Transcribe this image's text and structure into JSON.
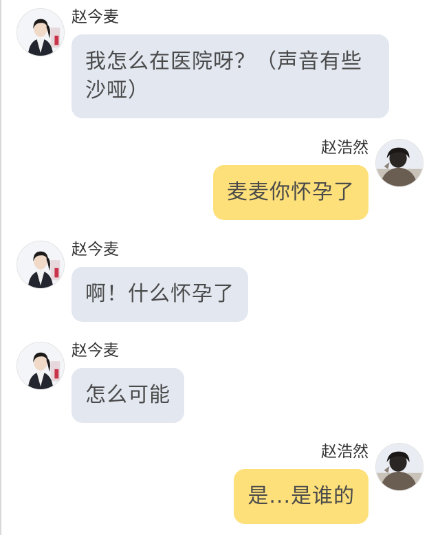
{
  "chat": {
    "messages": [
      {
        "side": "left",
        "sender": "赵今麦",
        "text": "我怎么在医院呀？（声音有些沙哑）",
        "avatar_icon": "girl-avatar-icon"
      },
      {
        "side": "right",
        "sender": "赵浩然",
        "text": "麦麦你怀孕了",
        "avatar_icon": "boy-avatar-icon"
      },
      {
        "side": "left",
        "sender": "赵今麦",
        "text": "啊！什么怀孕了",
        "avatar_icon": "girl-avatar-icon"
      },
      {
        "side": "left",
        "sender": "赵今麦",
        "text": "怎么可能",
        "avatar_icon": "girl-avatar-icon"
      },
      {
        "side": "right",
        "sender": "赵浩然",
        "text": "是...是谁的",
        "avatar_icon": "boy-avatar-icon"
      }
    ]
  },
  "colors": {
    "left_bubble": "#e2e7f0",
    "right_bubble": "#fde07a",
    "background": "#ffffff"
  }
}
